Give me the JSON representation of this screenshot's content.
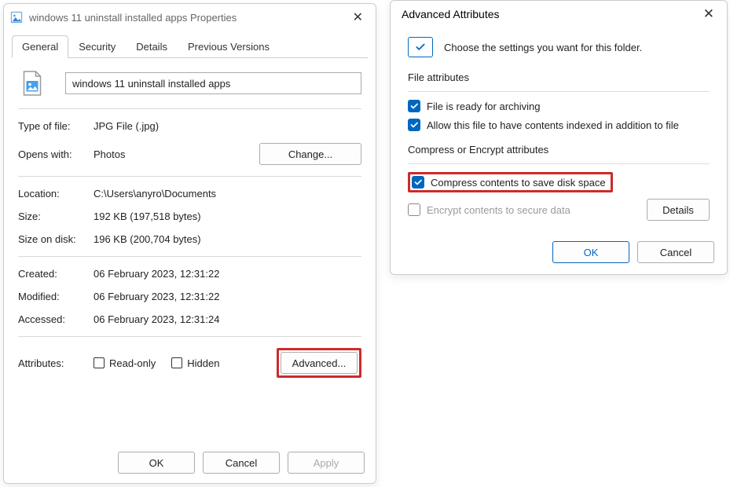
{
  "properties": {
    "title": "windows 11 uninstall installed apps Properties",
    "tabs": [
      "General",
      "Security",
      "Details",
      "Previous Versions"
    ],
    "filename": "windows 11 uninstall installed apps",
    "type_label": "Type of file:",
    "type_value": "JPG File (.jpg)",
    "opens_label": "Opens with:",
    "opens_value": "Photos",
    "change_btn": "Change...",
    "location_label": "Location:",
    "location_value": "C:\\Users\\anyro\\Documents",
    "size_label": "Size:",
    "size_value": "192 KB (197,518 bytes)",
    "diskSize_label": "Size on disk:",
    "diskSize_value": "196 KB (200,704 bytes)",
    "created_label": "Created:",
    "created_value": "06 February 2023, 12:31:22",
    "modified_label": "Modified:",
    "modified_value": "06 February 2023, 12:31:22",
    "accessed_label": "Accessed:",
    "accessed_value": "06 February 2023, 12:31:24",
    "attributes_label": "Attributes:",
    "readonly_label": "Read-only",
    "hidden_label": "Hidden",
    "advanced_btn": "Advanced...",
    "ok_btn": "OK",
    "cancel_btn": "Cancel",
    "apply_btn": "Apply"
  },
  "advanced": {
    "title": "Advanced Attributes",
    "intro": "Choose the settings you want for this folder.",
    "group1_label": "File attributes",
    "archive_label": "File is ready for archiving",
    "index_label": "Allow this file to have contents indexed in addition to file",
    "group2_label": "Compress or Encrypt attributes",
    "compress_label": "Compress contents to save disk space",
    "encrypt_label": "Encrypt contents to secure data",
    "details_btn": "Details",
    "ok_btn": "OK",
    "cancel_btn": "Cancel"
  }
}
